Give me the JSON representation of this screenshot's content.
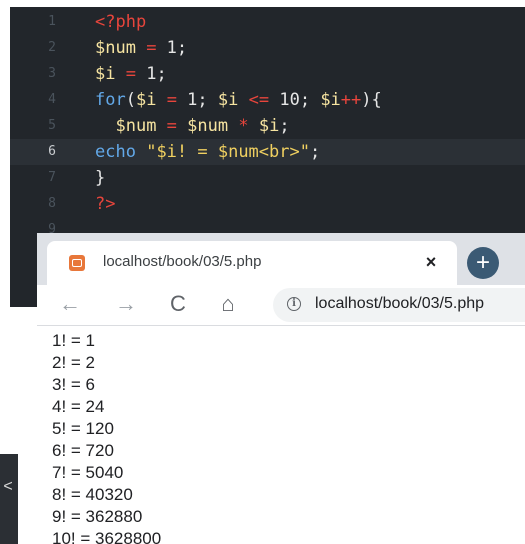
{
  "editor": {
    "lines": [
      {
        "num": "1",
        "tokens": [
          {
            "t": "<?php",
            "c": "c-tag"
          }
        ]
      },
      {
        "num": "2",
        "tokens": [
          {
            "t": "$num",
            "c": "c-var"
          },
          {
            "t": " = ",
            "c": "c-op"
          },
          {
            "t": "1",
            "c": "c-num"
          },
          {
            "t": ";",
            "c": "c-pun"
          }
        ]
      },
      {
        "num": "3",
        "tokens": [
          {
            "t": "$i",
            "c": "c-var"
          },
          {
            "t": " = ",
            "c": "c-op"
          },
          {
            "t": "1",
            "c": "c-num"
          },
          {
            "t": ";",
            "c": "c-pun"
          }
        ]
      },
      {
        "num": "4",
        "tokens": [
          {
            "t": "for",
            "c": "c-kw"
          },
          {
            "t": "(",
            "c": "c-pun"
          },
          {
            "t": "$i",
            "c": "c-var"
          },
          {
            "t": " = ",
            "c": "c-op"
          },
          {
            "t": "1",
            "c": "c-num"
          },
          {
            "t": "; ",
            "c": "c-pun"
          },
          {
            "t": "$i",
            "c": "c-var"
          },
          {
            "t": " <= ",
            "c": "c-op"
          },
          {
            "t": "10",
            "c": "c-num"
          },
          {
            "t": "; ",
            "c": "c-pun"
          },
          {
            "t": "$i",
            "c": "c-var"
          },
          {
            "t": "++",
            "c": "c-op"
          },
          {
            "t": "){",
            "c": "c-pun"
          }
        ]
      },
      {
        "num": "5",
        "tokens": [
          {
            "t": "  ",
            "c": "c-pun"
          },
          {
            "t": "$num",
            "c": "c-var"
          },
          {
            "t": " = ",
            "c": "c-op"
          },
          {
            "t": "$num",
            "c": "c-var"
          },
          {
            "t": " * ",
            "c": "c-op"
          },
          {
            "t": "$i",
            "c": "c-var"
          },
          {
            "t": ";",
            "c": "c-pun"
          }
        ]
      },
      {
        "num": "6",
        "active": true,
        "tokens": [
          {
            "t": "echo",
            "c": "c-kw"
          },
          {
            "t": " ",
            "c": "c-pun"
          },
          {
            "t": "\"$i! = $num<br>\"",
            "c": "c-str"
          },
          {
            "t": ";",
            "c": "c-pun"
          }
        ]
      },
      {
        "num": "7",
        "tokens": [
          {
            "t": "}",
            "c": "c-pun"
          }
        ]
      },
      {
        "num": "8",
        "tokens": [
          {
            "t": "?>",
            "c": "c-tag"
          }
        ]
      },
      {
        "num": "9",
        "tokens": []
      }
    ]
  },
  "browser": {
    "tab_title": "localhost/book/03/5.php",
    "tab_close": "×",
    "new_tab": "+",
    "back": "←",
    "forward": "→",
    "reload": "C",
    "home": "⌂",
    "info": "i",
    "url": "localhost/book/03/5.php"
  },
  "output": [
    "1! = 1",
    "2! = 2",
    "3! = 6",
    "4! = 24",
    "5! = 120",
    "6! = 720",
    "7! = 5040",
    "8! = 40320",
    "9! = 362880",
    "10! = 3628800"
  ],
  "sidebar_toggle": "<"
}
